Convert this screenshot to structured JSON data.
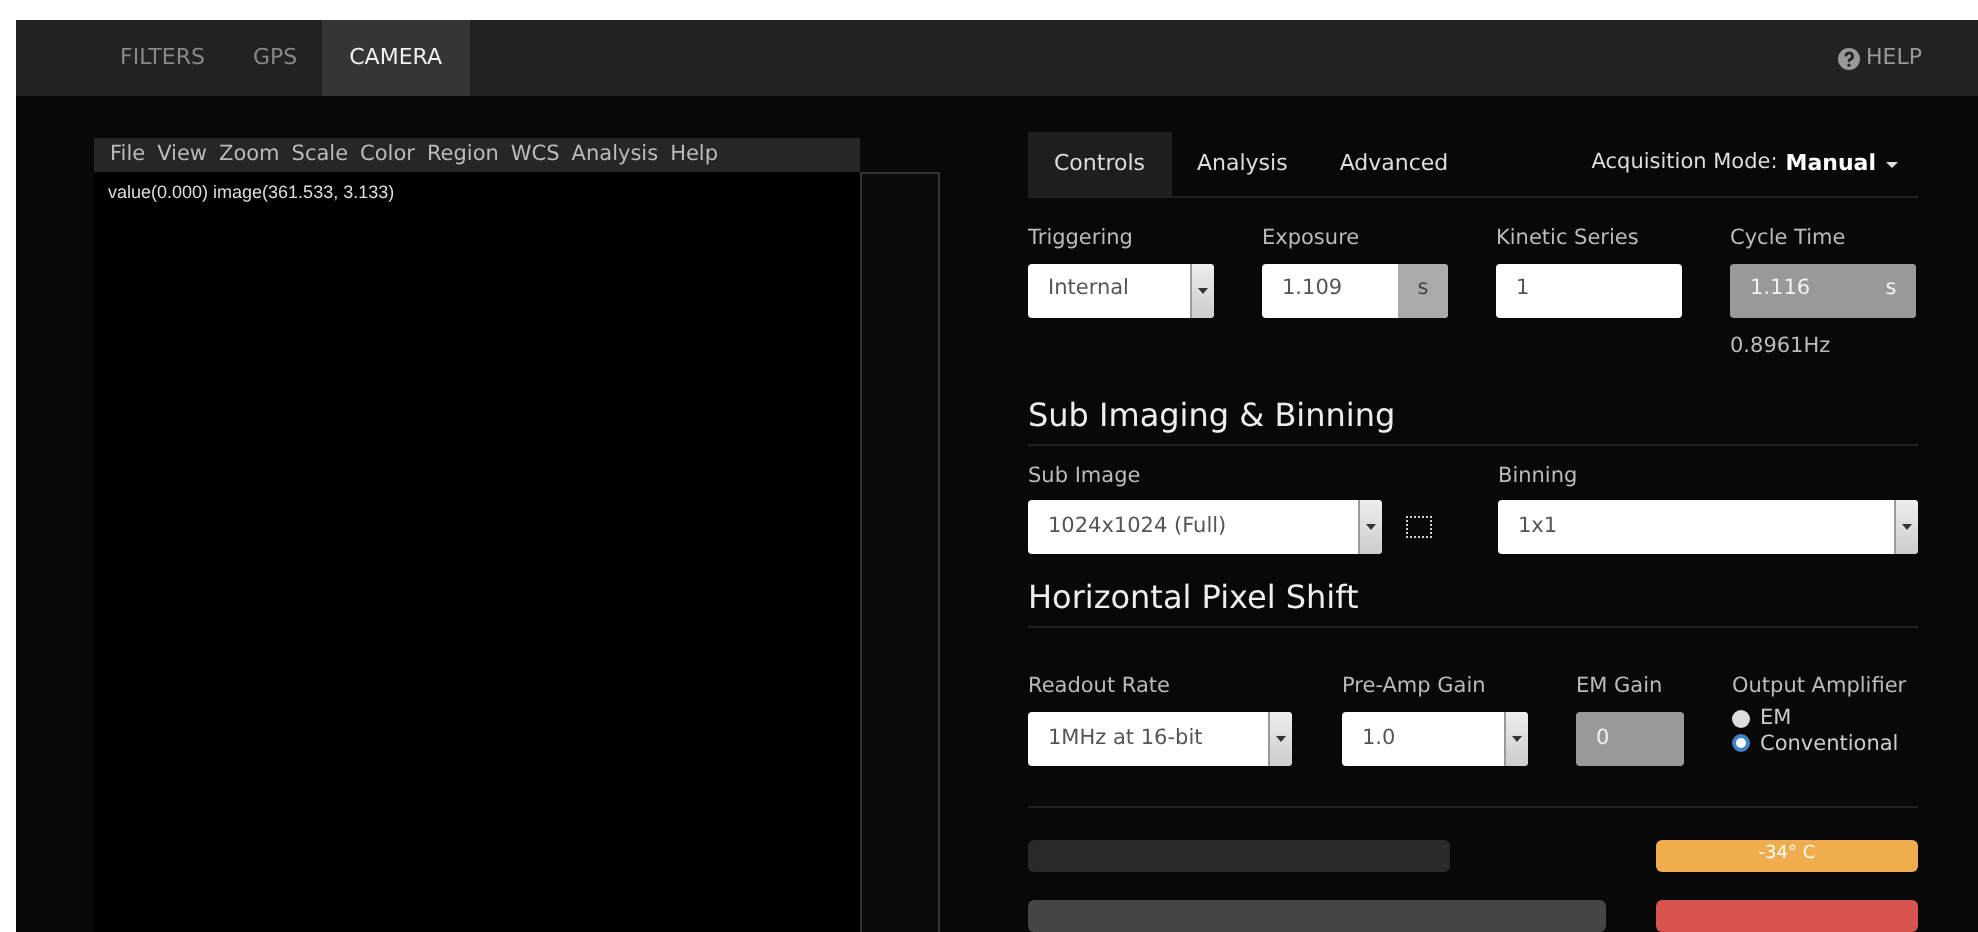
{
  "top_nav": {
    "tabs": [
      {
        "label": "FILTERS",
        "selected": false
      },
      {
        "label": "GPS",
        "selected": false
      },
      {
        "label": "CAMERA",
        "selected": true
      }
    ],
    "help": "HELP"
  },
  "viewer": {
    "menu": [
      "File",
      "View",
      "Zoom",
      "Scale",
      "Color",
      "Region",
      "WCS",
      "Analysis",
      "Help"
    ],
    "status": "value(0.000) image(361.533, 3.133)"
  },
  "panel": {
    "tabs": [
      {
        "label": "Controls",
        "selected": true
      },
      {
        "label": "Analysis",
        "selected": false
      },
      {
        "label": "Advanced",
        "selected": false
      }
    ],
    "mode_label": "Acquisition Mode:",
    "mode_value": "Manual",
    "acquisition": [
      {
        "kind": "select",
        "label": "Triggering",
        "value": "Internal",
        "disabled": false
      },
      {
        "kind": "unit_input",
        "label": "Exposure",
        "value": "1.109",
        "unit": "s",
        "disabled": false
      },
      {
        "kind": "input",
        "label": "Kinetic Series",
        "value": "1",
        "disabled": false
      },
      {
        "kind": "unit_input",
        "label": "Cycle Time",
        "value": "1.116",
        "unit": "s",
        "disabled": true,
        "note": "0.8961Hz"
      }
    ],
    "sub_imaging": {
      "title": "Sub Imaging & Binning",
      "fields": [
        {
          "kind": "select",
          "label": "Sub Image",
          "value": "1024x1024 (Full)",
          "disabled": false,
          "region_tool": true
        },
        {
          "kind": "select",
          "label": "Binning",
          "value": "1x1",
          "disabled": false
        }
      ]
    },
    "pixel_shift": {
      "title": "Horizontal Pixel Shift",
      "fields": [
        {
          "kind": "select",
          "label": "Readout Rate",
          "value": "1MHz at 16-bit",
          "disabled": false
        },
        {
          "kind": "select",
          "label": "Pre-Amp Gain",
          "value": "1.0",
          "disabled": false
        },
        {
          "kind": "input",
          "label": "EM Gain",
          "value": "0",
          "disabled": true
        },
        {
          "kind": "radio_group",
          "label": "Output Amplifier",
          "options": [
            {
              "label": "EM",
              "selected": false
            },
            {
              "label": "Conventional",
              "selected": true
            }
          ]
        }
      ]
    },
    "indicators": [
      {
        "bar": {
          "color": "#2a2a2a"
        },
        "badge": {
          "color": "#f0ad4e",
          "text": "-34° C"
        }
      },
      {
        "bar": {
          "color": "#454545"
        },
        "badge": {
          "color": "#d9534f"
        }
      }
    ]
  }
}
